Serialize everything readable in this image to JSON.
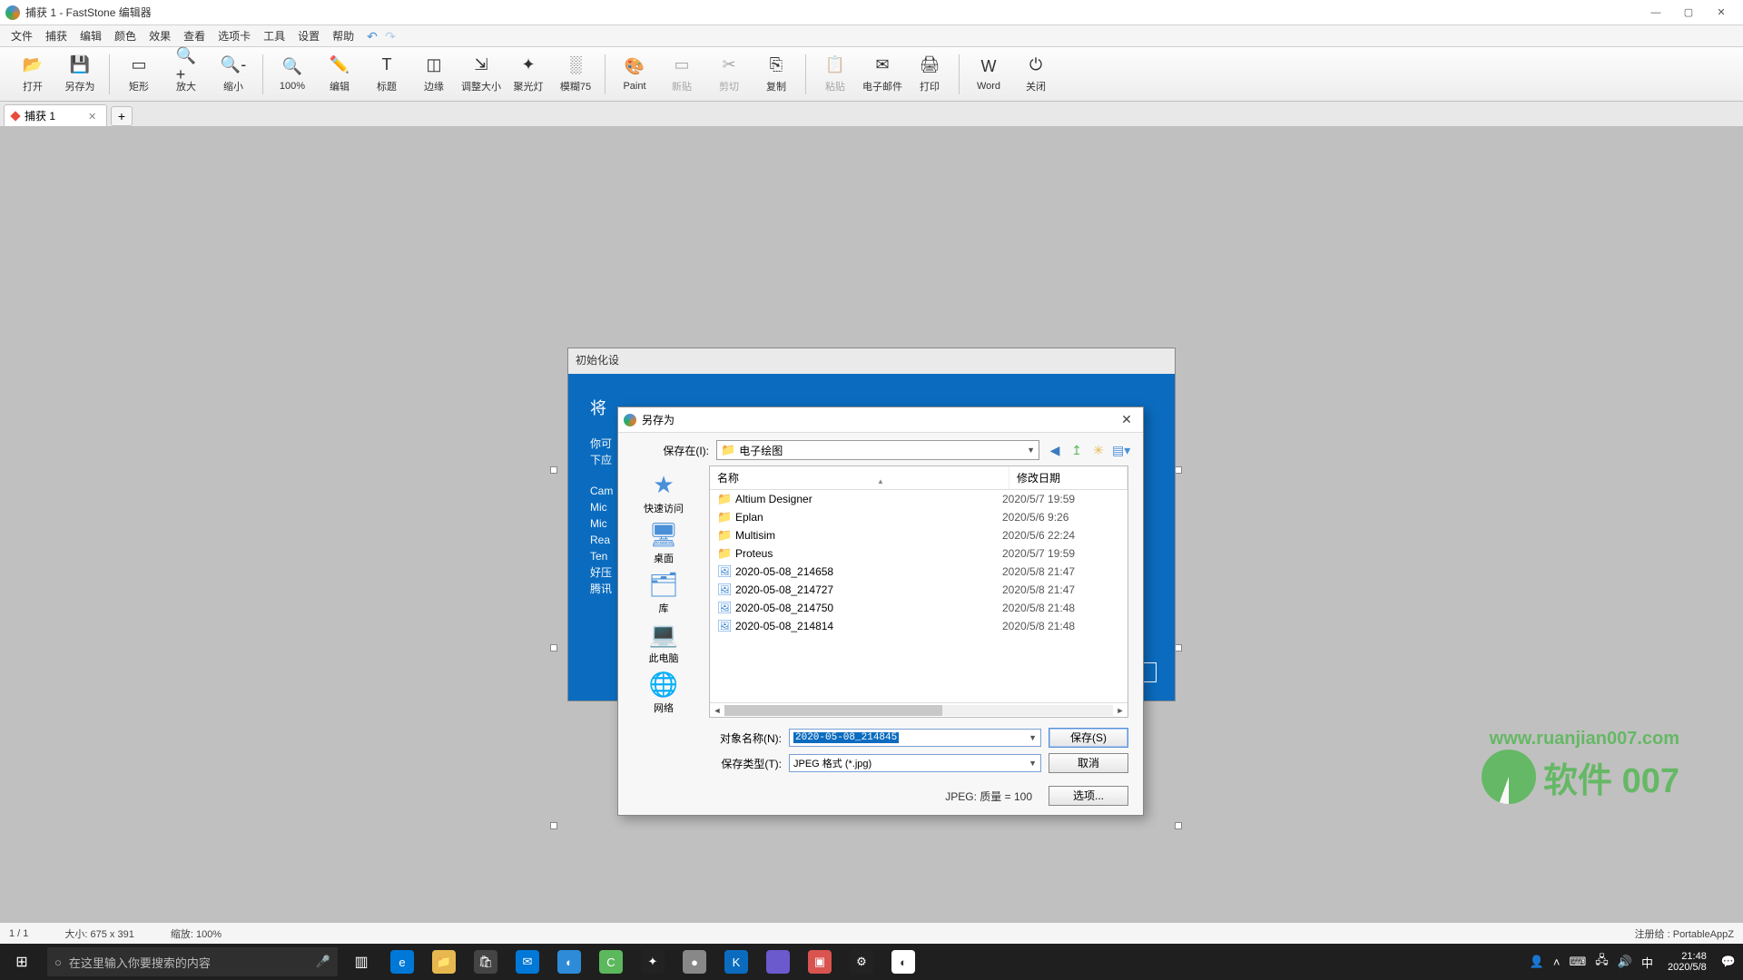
{
  "title": "捕获 1 - FastStone 编辑器",
  "menu": [
    "文件",
    "捕获",
    "编辑",
    "颜色",
    "效果",
    "查看",
    "选项卡",
    "工具",
    "设置",
    "帮助"
  ],
  "toolbar": [
    {
      "label": "打开",
      "icon": "📂"
    },
    {
      "label": "另存为",
      "icon": "💾"
    },
    {
      "label": "矩形",
      "icon": "▭"
    },
    {
      "label": "放大",
      "icon": "🔍+"
    },
    {
      "label": "缩小",
      "icon": "🔍-"
    },
    {
      "label": "100%",
      "icon": "🔍"
    },
    {
      "label": "编辑",
      "icon": "✏️"
    },
    {
      "label": "标题",
      "icon": "T"
    },
    {
      "label": "边缘",
      "icon": "◫"
    },
    {
      "label": "调整大小",
      "icon": "⇲"
    },
    {
      "label": "聚光灯",
      "icon": "✦"
    },
    {
      "label": "模糊75",
      "icon": "░"
    },
    {
      "label": "Paint",
      "icon": "🎨"
    },
    {
      "label": "新贴",
      "icon": "▭",
      "disabled": true
    },
    {
      "label": "剪切",
      "icon": "✂",
      "disabled": true
    },
    {
      "label": "复制",
      "icon": "⎘"
    },
    {
      "label": "粘贴",
      "icon": "📋",
      "disabled": true
    },
    {
      "label": "电子邮件",
      "icon": "✉"
    },
    {
      "label": "打印",
      "icon": "🖨"
    },
    {
      "label": "Word",
      "icon": "W"
    },
    {
      "label": "关闭",
      "icon": "⏻"
    }
  ],
  "tab": {
    "label": "捕获 1"
  },
  "bg": {
    "title": "初始化设",
    "heading": "将",
    "line1": "你可",
    "line2": "下应",
    "list": [
      "Cam",
      "Mic",
      "Mic",
      "Rea",
      "Ten",
      "好压",
      "腾讯"
    ]
  },
  "dialog": {
    "title": "另存为",
    "save_in_label": "保存在(I):",
    "path": "电子绘图",
    "places": [
      {
        "label": "快速访问",
        "icon": "★"
      },
      {
        "label": "桌面",
        "icon": "🖥"
      },
      {
        "label": "库",
        "icon": "🗂"
      },
      {
        "label": "此电脑",
        "icon": "💻"
      },
      {
        "label": "网络",
        "icon": "🌐"
      }
    ],
    "columns": {
      "name": "名称",
      "date": "修改日期"
    },
    "files": [
      {
        "name": "Altium Designer",
        "date": "2020/5/7 19:59",
        "type": "folder"
      },
      {
        "name": "Eplan",
        "date": "2020/5/6 9:26",
        "type": "folder"
      },
      {
        "name": "Multisim",
        "date": "2020/5/6 22:24",
        "type": "folder"
      },
      {
        "name": "Proteus",
        "date": "2020/5/7 19:59",
        "type": "folder"
      },
      {
        "name": "2020-05-08_214658",
        "date": "2020/5/8 21:47",
        "type": "image"
      },
      {
        "name": "2020-05-08_214727",
        "date": "2020/5/8 21:47",
        "type": "image"
      },
      {
        "name": "2020-05-08_214750",
        "date": "2020/5/8 21:48",
        "type": "image"
      },
      {
        "name": "2020-05-08_214814",
        "date": "2020/5/8 21:48",
        "type": "image"
      }
    ],
    "filename_label": "对象名称(N):",
    "filename_value": "2020-05-08_214845",
    "filetype_label": "保存类型(T):",
    "filetype_value": "JPEG 格式 (*.jpg)",
    "save_btn": "保存(S)",
    "cancel_btn": "取消",
    "quality": "JPEG: 质量 = 100",
    "options_btn": "选项..."
  },
  "status": {
    "page": "1 / 1",
    "size": "大小: 675 x 391",
    "zoom": "缩放: 100%",
    "right": "注册给 : PortableAppZ"
  },
  "watermark": {
    "url": "www.ruanjian007.com",
    "text": "软件 007"
  },
  "taskbar": {
    "search_placeholder": "在这里输入你要搜索的内容",
    "clock": {
      "time": "21:48",
      "date": "2020/5/8"
    }
  }
}
